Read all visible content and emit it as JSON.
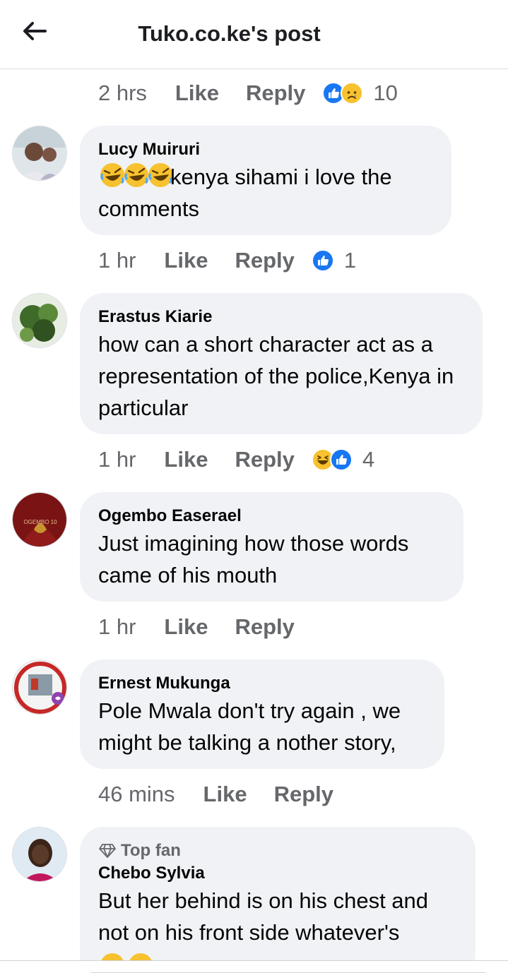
{
  "header": {
    "title": "Tuko.co.ke's post"
  },
  "top_meta": {
    "time": "2 hrs",
    "like": "Like",
    "reply": "Reply",
    "count": "10",
    "reactions": [
      "like-icon",
      "sad-icon"
    ]
  },
  "comments": [
    {
      "author": "Lucy Muiruri",
      "text": "kenya sihami i love the comments",
      "emoji_prefix": [
        "rolling-laughing-icon",
        "rolling-laughing-icon",
        "rolling-laughing-icon"
      ],
      "meta": {
        "time": "1 hr",
        "like": "Like",
        "reply": "Reply",
        "count": "1",
        "reactions": [
          "like-icon"
        ]
      }
    },
    {
      "author": "Erastus Kiarie",
      "text": "how can a short character act as a representation of the police,Kenya in particular",
      "meta": {
        "time": "1 hr",
        "like": "Like",
        "reply": "Reply",
        "count": "4",
        "reactions": [
          "haha-icon",
          "like-icon"
        ]
      }
    },
    {
      "author": "Ogembo Easerael",
      "text": "Just imagining how those words came of his mouth",
      "meta": {
        "time": "1 hr",
        "like": "Like",
        "reply": "Reply"
      }
    },
    {
      "author": "Ernest Mukunga",
      "text": "Pole Mwala don't try again , we might be talking a nother story,",
      "meta": {
        "time": "46 mins",
        "like": "Like",
        "reply": "Reply"
      }
    },
    {
      "badge": "Top fan",
      "author": "Chebo Sylvia",
      "text": "But her behind is on his chest and not on his front side whatever's",
      "emoji_suffix": [
        "laughing-tears-icon",
        "laughing-tears-icon"
      ]
    }
  ],
  "colors": {
    "like_blue": "#1877f2",
    "bubble_bg": "#f0f2f5",
    "meta_grey": "#65676b",
    "emoji_yellow": "#f7c12f"
  }
}
